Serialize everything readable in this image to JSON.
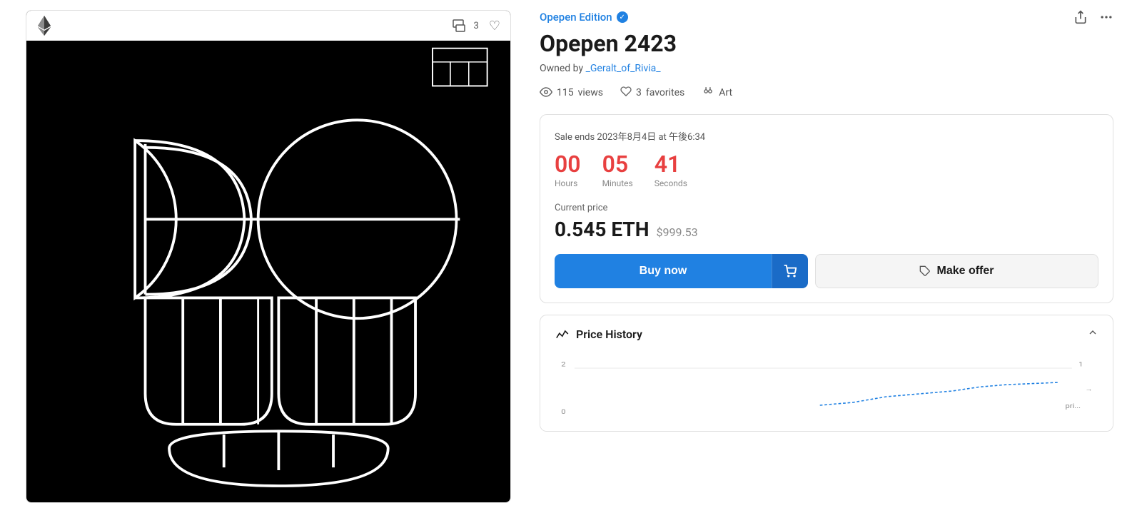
{
  "left_panel": {
    "fav_count": "3",
    "eth_icon": "♦"
  },
  "collection": {
    "name": "Opepen Edition",
    "verified": true,
    "share_icon": "share",
    "more_icon": "more"
  },
  "nft": {
    "title": "Opepen 2423",
    "owned_by_label": "Owned by",
    "owner": "_Geralt_of_Rivia_"
  },
  "stats": {
    "views_count": "115",
    "views_label": "views",
    "favorites_count": "3",
    "favorites_label": "favorites",
    "category": "Art"
  },
  "sale": {
    "ends_text": "Sale ends 2023年8月4日 at 午後6:34",
    "hours": "00",
    "minutes": "05",
    "seconds": "41",
    "hours_label": "Hours",
    "minutes_label": "Minutes",
    "seconds_label": "Seconds",
    "current_price_label": "Current price",
    "eth_price": "0.545 ETH",
    "usd_price": "$999.53"
  },
  "buttons": {
    "buy_now": "Buy now",
    "make_offer": "Make offer"
  },
  "price_history": {
    "title": "Price History",
    "y_label_top": "2",
    "y_label_bottom": "0",
    "y_right_top": "1",
    "y_right_label": "pri...",
    "arrow_right": "→"
  }
}
